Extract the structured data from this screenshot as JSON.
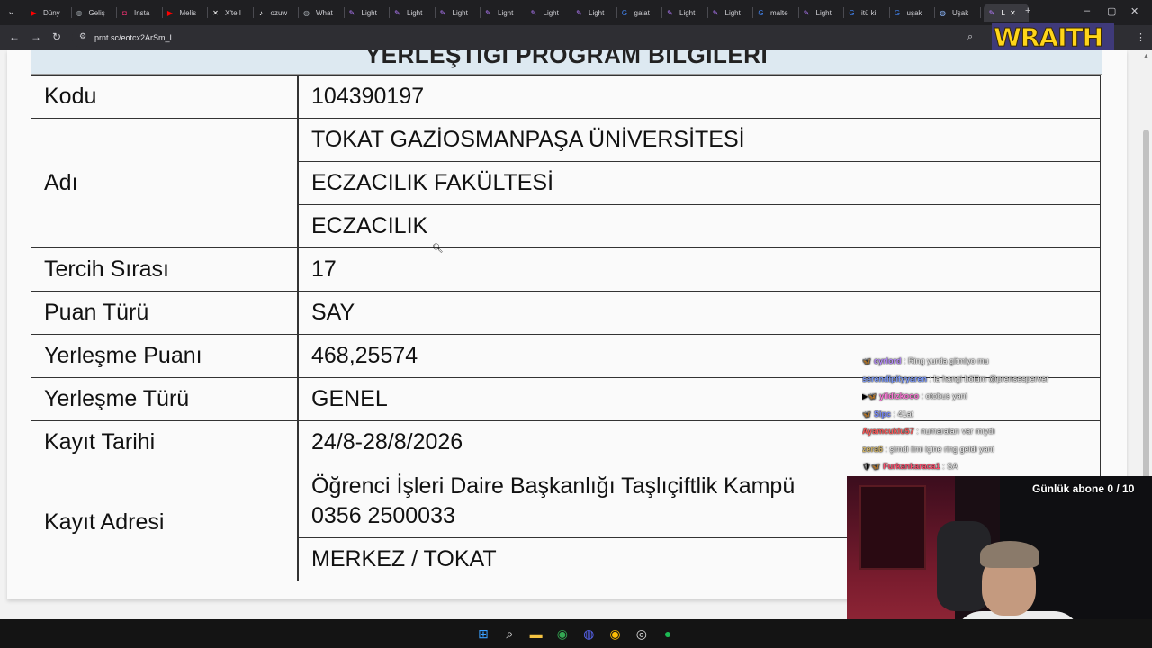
{
  "tabs": [
    {
      "label": "Düny",
      "icon": "youtube-icon",
      "color": "#ff0000"
    },
    {
      "label": "Geliş",
      "icon": "globe-icon",
      "color": "#9aa0a6"
    },
    {
      "label": "Insta",
      "icon": "instagram-icon",
      "color": "#e1306c"
    },
    {
      "label": "Melis",
      "icon": "youtube-icon",
      "color": "#ff0000"
    },
    {
      "label": "X'te I",
      "icon": "x-icon",
      "color": "#ffffff"
    },
    {
      "label": "ozuw",
      "icon": "tiktok-icon",
      "color": "#ffffff"
    },
    {
      "label": "What",
      "icon": "globe-icon",
      "color": "#9aa0a6"
    },
    {
      "label": "Light",
      "icon": "quill-icon",
      "color": "#b57bff"
    },
    {
      "label": "Light",
      "icon": "quill-icon",
      "color": "#b57bff"
    },
    {
      "label": "Light",
      "icon": "quill-icon",
      "color": "#b57bff"
    },
    {
      "label": "Light",
      "icon": "quill-icon",
      "color": "#b57bff"
    },
    {
      "label": "Light",
      "icon": "quill-icon",
      "color": "#b57bff"
    },
    {
      "label": "Light",
      "icon": "quill-icon",
      "color": "#b57bff"
    },
    {
      "label": "galat",
      "icon": "google-icon",
      "color": "#4285f4"
    },
    {
      "label": "Light",
      "icon": "quill-icon",
      "color": "#b57bff"
    },
    {
      "label": "Light",
      "icon": "quill-icon",
      "color": "#b57bff"
    },
    {
      "label": "malte",
      "icon": "google-icon",
      "color": "#4285f4"
    },
    {
      "label": "Light",
      "icon": "quill-icon",
      "color": "#b57bff"
    },
    {
      "label": "itü ki",
      "icon": "google-icon",
      "color": "#4285f4"
    },
    {
      "label": "uşak",
      "icon": "google-icon",
      "color": "#4285f4"
    },
    {
      "label": "Uşak",
      "icon": "globe-icon",
      "color": "#8ab4f8"
    },
    {
      "label": "L",
      "icon": "quill-icon",
      "color": "#b57bff",
      "active": true
    }
  ],
  "address_bar": {
    "url": "prnt.sc/eotcx2ArSm_L"
  },
  "overlay_logo": "WRAITH",
  "table": {
    "heading": "YERLEŞTİĞİ PROGRAM BİLGİLERİ",
    "rows": [
      {
        "label": "Kodu",
        "values": [
          "104390197"
        ]
      },
      {
        "label": "Adı",
        "values": [
          "TOKAT GAZİOSMANPAŞA ÜNİVERSİTESİ",
          "ECZACILIK FAKÜLTESİ",
          "ECZACILIK"
        ]
      },
      {
        "label": "Tercih Sırası",
        "values": [
          "17"
        ]
      },
      {
        "label": "Puan Türü",
        "values": [
          "SAY"
        ]
      },
      {
        "label": "Yerleşme Puanı",
        "values": [
          "468,25574"
        ]
      },
      {
        "label": "Yerleşme Türü",
        "values": [
          "GENEL"
        ]
      },
      {
        "label": "Kayıt Tarihi",
        "values": [
          "24/8-28/8/2026"
        ]
      },
      {
        "label": "Kayıt Adresi",
        "address_lines": [
          "Öğrenci İşleri Daire Başkanlığı Taşlıçiftlik Kampü",
          "0356 2500033"
        ],
        "values": [
          "MERKEZ / TOKAT"
        ]
      }
    ]
  },
  "chat": [
    {
      "user": "cyrlord",
      "text": "Ring yurda gitmiyo mu",
      "color": "#b88cff",
      "badge": "🦋"
    },
    {
      "user": "serendipityyaren",
      "text": "la hangi bölüm @prensesperver",
      "color": "#7d9cff",
      "badge": ""
    },
    {
      "user": "yildizkooo",
      "text": "otobus yani",
      "color": "#ff79d9",
      "badge": "▶🦋"
    },
    {
      "user": "Sipc",
      "text": "41at",
      "color": "#7a8cff",
      "badge": "🦋"
    },
    {
      "user": "Ayamcuklu57",
      "text": "numaraları var mıydı",
      "color": "#ff5a5a",
      "badge": ""
    },
    {
      "user": "zera6",
      "text": "şimdi ilmi içine ring geldi yani",
      "color": "#d4b86a",
      "badge": ""
    },
    {
      "user": "Furkankaraca1",
      "text": "SA",
      "color": "#ff4d6d",
      "badge": "🛡🦋"
    }
  ],
  "subscriber_goal": "Günlük abone 0 / 10",
  "taskbar": [
    {
      "icon": "windows-start-icon",
      "glyph": "⊞",
      "color": "#3aa0ff"
    },
    {
      "icon": "search-icon",
      "glyph": "⌕",
      "color": "#ffffff"
    },
    {
      "icon": "file-explorer-icon",
      "glyph": "▬",
      "color": "#f5c342"
    },
    {
      "icon": "chrome-icon",
      "glyph": "◉",
      "color": "#34a853"
    },
    {
      "icon": "discord-icon",
      "glyph": "◍",
      "color": "#5865f2"
    },
    {
      "icon": "chrome-icon",
      "glyph": "◉",
      "color": "#fbbc05"
    },
    {
      "icon": "obs-icon",
      "glyph": "◎",
      "color": "#dddddd"
    },
    {
      "icon": "spotify-icon",
      "glyph": "●",
      "color": "#1db954"
    }
  ]
}
